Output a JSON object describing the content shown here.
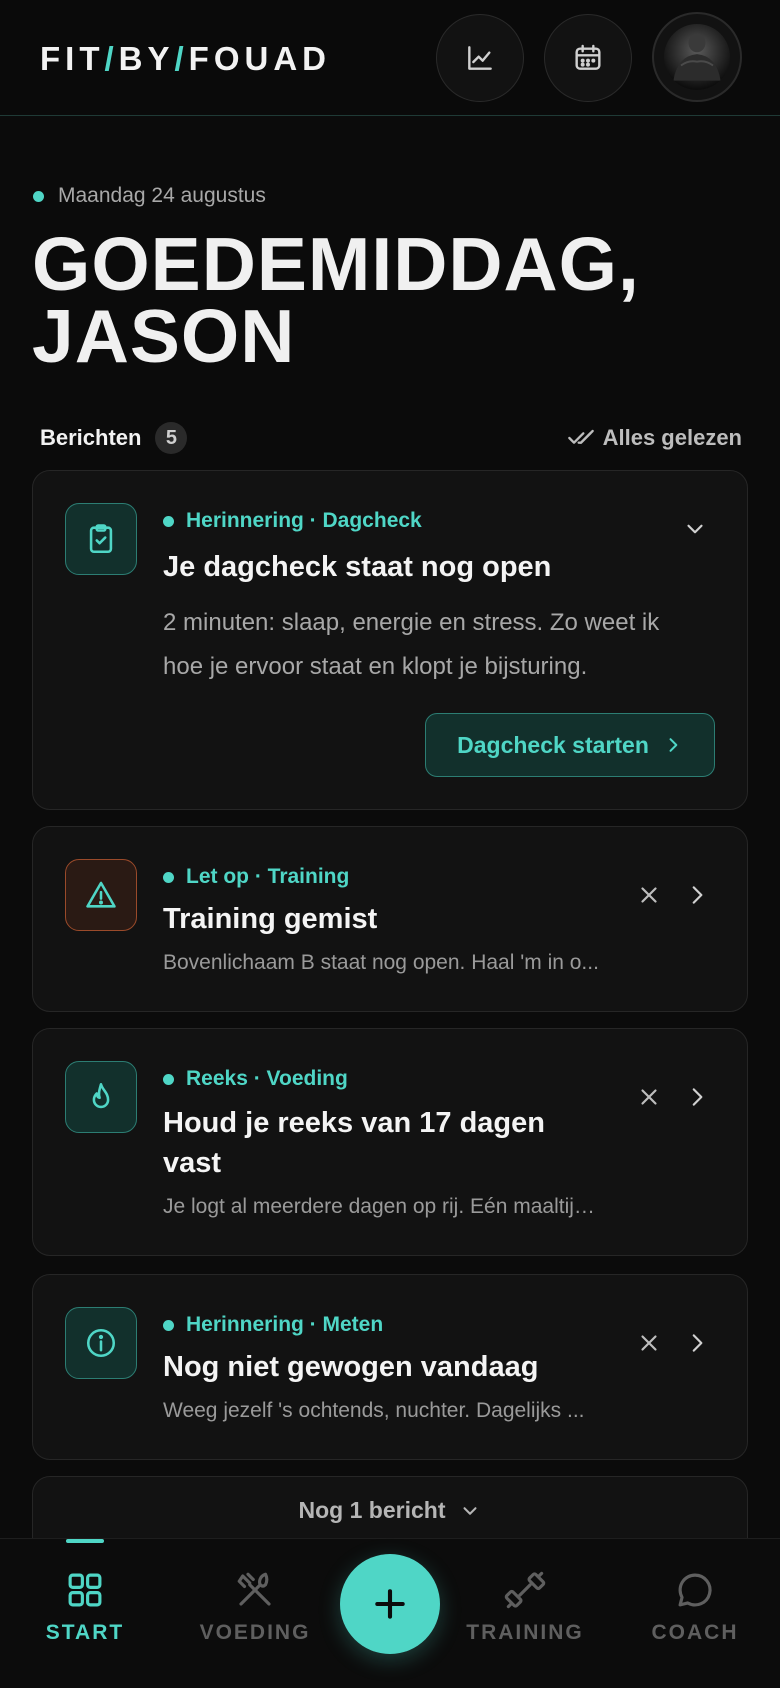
{
  "colors": {
    "accent": "#4fd6c6",
    "background": "#0b0b0b",
    "card": "#121212",
    "warning": "#e08a5a"
  },
  "header": {
    "logo_parts": [
      "FIT",
      "/",
      "BY",
      "/",
      "FOUAD"
    ],
    "buttons": [
      {
        "icon": "chart-line-icon"
      },
      {
        "icon": "calendar-icon"
      }
    ],
    "avatar_icon": "profile-photo"
  },
  "greeting": {
    "date": "Maandag 24 augustus",
    "line1": "GOEDEMIDDAG,",
    "line2": "JASON"
  },
  "messages": {
    "title": "Berichten",
    "count": "5",
    "mark_all_read": "Alles gelezen",
    "items": [
      {
        "icon": "clipboard-check-icon",
        "category": "Herinnering · Dagcheck",
        "title": "Je dagcheck staat nog open",
        "body": "2 minuten: slaap, energie en stress. Zo weet ik hoe je ervoor staat en klopt je bijsturing.",
        "cta": "Dagcheck starten",
        "expanded": true
      },
      {
        "icon": "warning-triangle-icon",
        "category": "Let op · Training",
        "title": "Training gemist",
        "body": "Bovenlichaam B staat nog open. Haal 'm in o..."
      },
      {
        "icon": "flame-icon",
        "category": "Reeks · Voeding",
        "title_line1": "Houd je reeks van 17 dagen",
        "title_line2": "vast",
        "body": "Je logt al meerdere dagen op rij. Eén maaltijd..."
      },
      {
        "icon": "info-circle-icon",
        "category": "Herinnering · Meten",
        "title": "Nog niet gewogen vandaag",
        "body": "Weeg jezelf 's ochtends, nuchter. Dagelijks ..."
      }
    ],
    "more_label": "Nog 1 bericht"
  },
  "nav": {
    "items": [
      {
        "label": "START",
        "icon": "grid-icon",
        "active": true
      },
      {
        "label": "VOEDING",
        "icon": "utensils-icon"
      },
      {
        "label": "TRAINING",
        "icon": "dumbbell-icon"
      },
      {
        "label": "COACH",
        "icon": "chat-bubble-icon"
      }
    ],
    "fab_icon": "plus-icon"
  }
}
